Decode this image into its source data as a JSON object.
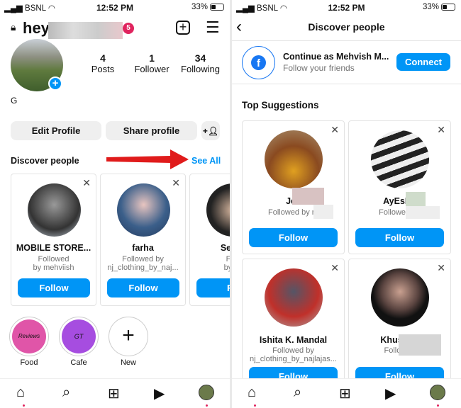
{
  "status_bar": {
    "carrier": "BSNL",
    "time": "12:52 PM",
    "battery": "33%"
  },
  "profile": {
    "username_visible": "hey.",
    "notification_badge": "5",
    "stats": [
      {
        "value": "4",
        "label": "Posts"
      },
      {
        "value": "1",
        "label": "Follower"
      },
      {
        "value": "34",
        "label": "Following"
      }
    ],
    "display_name": "G",
    "edit_profile": "Edit Profile",
    "share_profile": "Share profile",
    "discover_title": "Discover people",
    "see_all": "See All",
    "suggestions": [
      {
        "name": "MOBILE STORE...",
        "line1": "Followed",
        "line2": "by mehviish",
        "follow": "Follow"
      },
      {
        "name": "farha",
        "line1": "Followed by",
        "line2": "nj_clothing_by_naj...",
        "follow": "Follow"
      },
      {
        "name": "Semc",
        "line1": "Foll",
        "line2": "by m",
        "follow": "Fo"
      }
    ],
    "highlights": [
      {
        "label": "Food",
        "inner": "Reviews"
      },
      {
        "label": "Cafe",
        "inner": "GT"
      },
      {
        "label": "New"
      }
    ]
  },
  "discover": {
    "title": "Discover people",
    "fb_title": "Continue as Mehvish M...",
    "fb_sub": "Follow your friends",
    "connect": "Connect",
    "section": "Top Suggestions",
    "cards": [
      {
        "name": "Jee",
        "sub1": "Followed by m",
        "follow": "Follow"
      },
      {
        "name": "AyEsHa",
        "sub1": "Followed by",
        "follow": "Follow"
      },
      {
        "name": "Ishita K. Mandal",
        "sub1": "Followed by",
        "sub2": "nj_clothing_by_najlajas...",
        "follow": "Follow"
      },
      {
        "name": "Khushbo",
        "sub1": "Followed",
        "follow": "Follow"
      }
    ]
  },
  "colors": {
    "accent": "#0095f6",
    "badge": "#e0245e",
    "arrow": "#e01b1b"
  }
}
